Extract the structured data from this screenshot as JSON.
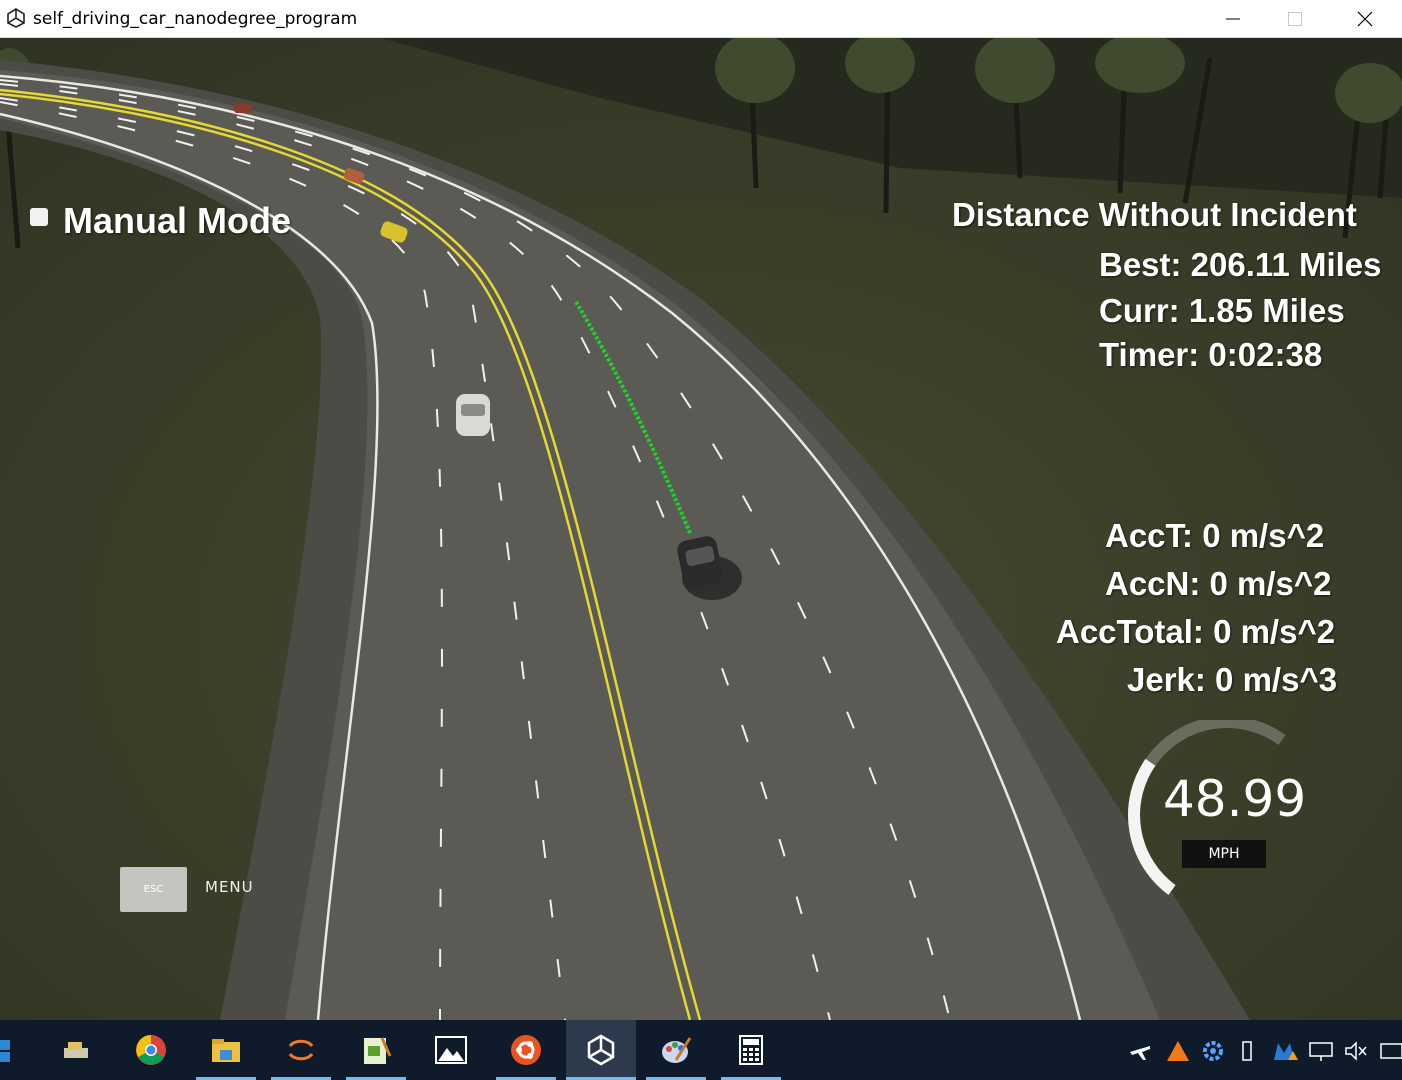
{
  "window": {
    "title": "self_driving_car_nanodegree_program",
    "controls": [
      "minimize",
      "maximize",
      "close"
    ]
  },
  "hud": {
    "mode_label": "Manual Mode",
    "distance_title": "Distance Without Incident",
    "best": "Best: 206.11 Miles",
    "curr": "Curr: 1.85 Miles",
    "timer": "Timer: 0:02:38",
    "acc_t": "AccT: 0 m/s^2",
    "acc_n": "AccN: 0 m/s^2",
    "acc_total": "AccTotal: 0 m/s^2",
    "jerk": "Jerk: 0 m/s^3",
    "speed": "48.99",
    "speed_unit": "MPH",
    "speed_gauge_fraction": 0.49,
    "esc_key": "ESC",
    "menu_label": "MENU"
  },
  "taskbar": {
    "items": [
      {
        "name": "windows-icon"
      },
      {
        "name": "installer-icon"
      },
      {
        "name": "chrome-icon"
      },
      {
        "name": "file-explorer-icon"
      },
      {
        "name": "jupyter-icon"
      },
      {
        "name": "notepad-icon"
      },
      {
        "name": "photos-icon"
      },
      {
        "name": "ubuntu-icon"
      },
      {
        "name": "unity-icon",
        "active": true
      },
      {
        "name": "paint-icon"
      },
      {
        "name": "calculator-icon"
      }
    ],
    "tray": [
      "airplane-icon",
      "avast-icon",
      "settings-icon",
      "usb-icon",
      "malwarebytes-icon",
      "network-icon",
      "volume-mute-icon",
      "keyboard-icon"
    ]
  },
  "colors": {
    "grass": "#3a3e2a",
    "road": "#5b5a55",
    "center_line": "#e6d832",
    "path": "#1fd12a"
  }
}
